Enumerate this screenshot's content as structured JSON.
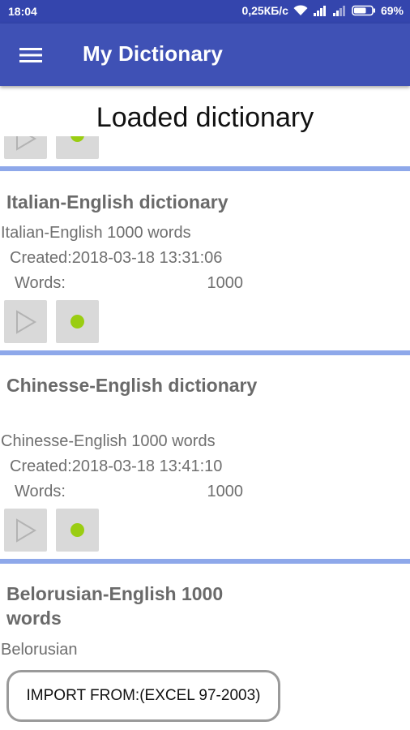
{
  "status_bar": {
    "time": "18:04",
    "network_speed": "0,25КБ/с",
    "battery_percent": "69%",
    "battery_level": 0.69
  },
  "app_bar": {
    "title": "My Dictionary"
  },
  "page": {
    "title": "Loaded dictionary"
  },
  "dictionaries": [
    {
      "title": "Italian-English dictionary",
      "subtitle": "Italian-English 1000 words",
      "created": "Created:2018-03-18 13:31:06",
      "words_label": "Words:",
      "words_value": "1000"
    },
    {
      "title": "Chinesse-English dictionary",
      "subtitle": "Chinesse-English 1000 words",
      "created": "Created:2018-03-18 13:41:10",
      "words_label": "Words:",
      "words_value": "1000"
    },
    {
      "title": "Belorusian-English 1000 words",
      "subtitle": "Belorusian"
    }
  ],
  "import_button": {
    "label": "IMPORT FROM:(EXCEL 97-2003)"
  },
  "colors": {
    "status_bar": "#3445ad",
    "app_bar": "#3f51b5",
    "divider": "#8ea8ea",
    "dot": "#9acd12"
  },
  "icons": {
    "menu": "hamburger-menu-icon",
    "play": "play-triangle-icon",
    "dot": "green-dot-icon",
    "wifi": "wifi-icon",
    "signal": "signal-icon",
    "battery": "battery-icon"
  }
}
